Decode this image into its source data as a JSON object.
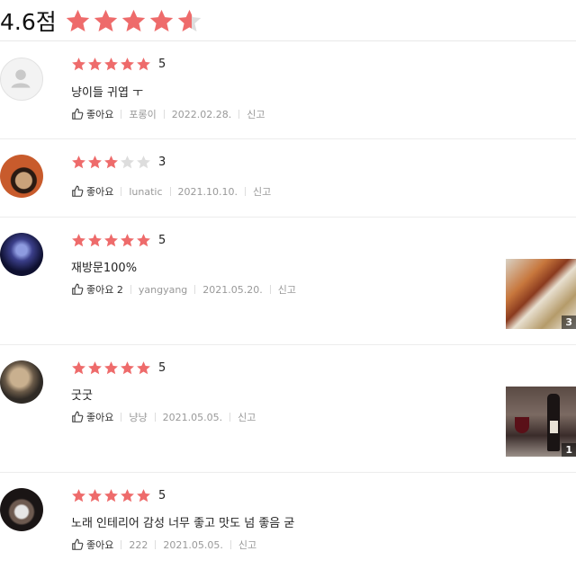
{
  "summary": {
    "score": "4.6점",
    "rating": 4.6
  },
  "colors": {
    "star_on": "#ee6b6b",
    "star_off": "#dddddd"
  },
  "reviews": [
    {
      "rating": 5,
      "rating_label": "5",
      "text": "냥이들 귀엽 ㅜ",
      "like_label": "좋아요",
      "author": "포롱이",
      "date": "2022.02.28.",
      "report_label": "신고",
      "avatar": "default-user-icon"
    },
    {
      "rating": 3,
      "rating_label": "3",
      "text": "",
      "like_label": "좋아요",
      "author": "lunatic",
      "date": "2021.10.10.",
      "report_label": "신고",
      "avatar": "cat-photo"
    },
    {
      "rating": 5,
      "rating_label": "5",
      "text": "재방문100%",
      "like_label": "좋아요 2",
      "author": "yangyang",
      "date": "2021.05.20.",
      "report_label": "신고",
      "avatar": "blue-night-photo",
      "photo_count": "3"
    },
    {
      "rating": 5,
      "rating_label": "5",
      "text": "굿굿",
      "like_label": "좋아요",
      "author": "냥냥",
      "date": "2021.05.05.",
      "report_label": "신고",
      "avatar": "dog-photo",
      "photo_count": "1"
    },
    {
      "rating": 5,
      "rating_label": "5",
      "text": "노래 인테리어 감성 너무 좋고 맛도 넘 좋음 굳",
      "like_label": "좋아요",
      "author": "222",
      "date": "2021.05.05.",
      "report_label": "신고",
      "avatar": "masked-person-photo"
    }
  ]
}
